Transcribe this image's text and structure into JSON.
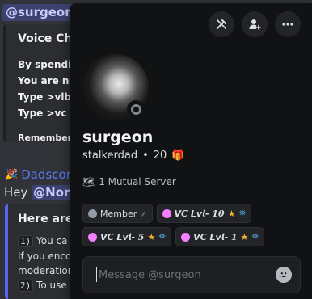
{
  "background_chat": {
    "top_mention": "@surgeon",
    "embed1": {
      "title": "Voice Cha",
      "lines": [
        "By spendin",
        "You are no",
        "Type >vlb t",
        "Type >vc t"
      ],
      "remember": "Remember :"
    },
    "message2": {
      "author": "Dadscore",
      "text_prefix": "Hey ",
      "mention": "@North"
    },
    "embed2": {
      "title": "Here are",
      "items": [
        {
          "code": "1)",
          "text": " You ca"
        },
        {
          "code": "",
          "text": "If you enco"
        },
        {
          "code": "",
          "text": "moderation"
        },
        {
          "code": "2)",
          "text": " To use"
        }
      ]
    }
  },
  "profile": {
    "actions": [
      {
        "name": "remove-friend-icon"
      },
      {
        "name": "add-friend-icon"
      },
      {
        "name": "more-options-icon"
      }
    ],
    "display_name": "surgeon",
    "username": "stalkerdad",
    "separator": "•",
    "age": "20",
    "gift_icon": "gift-icon",
    "mutual_servers": "1 Mutual Server",
    "status": "offline",
    "roles": [
      {
        "dot_color": "#949ba4",
        "label": "Member",
        "style": "plain",
        "suffix": "⸙",
        "star": "",
        "badge": ""
      },
      {
        "dot_color": "#f47fff",
        "label": "𝙑𝘾 𝙇𝙫𝙡- 10",
        "style": "fancy",
        "suffix": "",
        "star": "★",
        "badge": "⛯"
      },
      {
        "dot_color": "#f47fff",
        "label": "𝙑𝘾 𝙇𝙫𝙡- 5",
        "style": "fancy",
        "suffix": "",
        "star": "★",
        "badge": "⛯"
      },
      {
        "dot_color": "#f47fff",
        "label": "𝙑𝘾 𝙇𝙫𝙡- 1",
        "style": "fancy",
        "suffix": "",
        "star": "★",
        "badge": "⛯"
      }
    ],
    "message_placeholder": "Message @surgeon"
  },
  "colors": {
    "popout_bg": "#111214",
    "mention_bg": "#3c4270",
    "accent": "#5865f2"
  }
}
